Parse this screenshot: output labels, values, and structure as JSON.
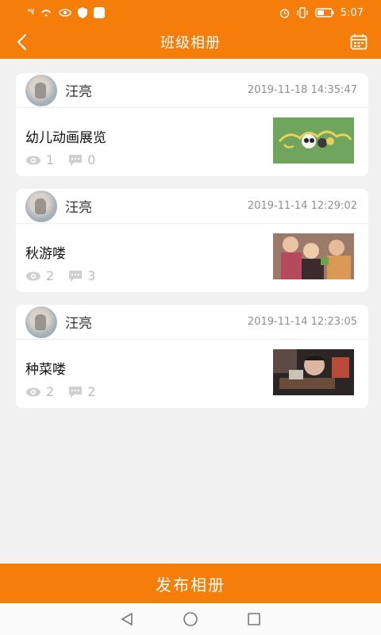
{
  "status_bar": {
    "signal": "⁴⁶ıl",
    "time": "5:07"
  },
  "header": {
    "title": "班级相册"
  },
  "albums": [
    {
      "author": "汪亮",
      "datetime": "2019-11-18 14:35:47",
      "title": "幼儿动画展览",
      "views": "1",
      "comments": "0"
    },
    {
      "author": "汪亮",
      "datetime": "2019-11-14 12:29:02",
      "title": "秋游喽",
      "views": "2",
      "comments": "3"
    },
    {
      "author": "汪亮",
      "datetime": "2019-11-14 12:23:05",
      "title": "种菜喽",
      "views": "2",
      "comments": "2"
    }
  ],
  "footer": {
    "publish_label": "发布相册"
  },
  "colors": {
    "accent": "#f57d0a",
    "background": "#f1f1f1"
  },
  "icons": [
    "back-arrow-icon",
    "calendar-icon",
    "eye-icon",
    "comment-icon",
    "nav-back-icon",
    "nav-home-icon",
    "nav-recents-icon"
  ]
}
